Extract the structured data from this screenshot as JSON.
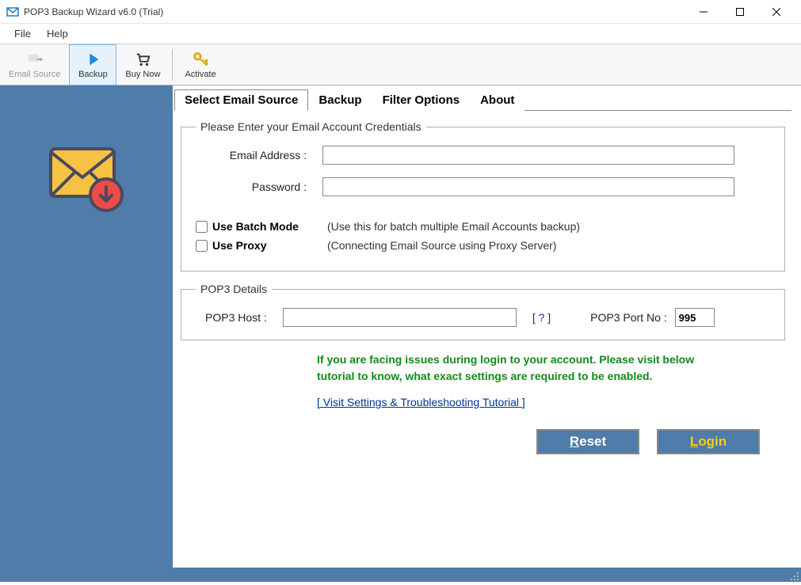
{
  "window": {
    "title": "POP3 Backup Wizard v6.0 (Trial)"
  },
  "menu": {
    "file": "File",
    "help": "Help"
  },
  "toolbar": {
    "email_source": "Email Source",
    "backup": "Backup",
    "buy_now": "Buy Now",
    "activate": "Activate"
  },
  "tabs": {
    "select_email_source": "Select Email Source",
    "backup": "Backup",
    "filter_options": "Filter Options",
    "about": "About"
  },
  "credentials": {
    "legend": "Please Enter your Email Account Credentials",
    "email_label": "Email Address :",
    "email_value": "",
    "password_label": "Password :",
    "password_value": "",
    "batch_label": "Use Batch Mode",
    "batch_hint": "(Use this for batch multiple Email Accounts backup)",
    "proxy_label": "Use Proxy",
    "proxy_hint": "(Connecting Email Source using Proxy Server)"
  },
  "pop3": {
    "legend": "POP3 Details",
    "host_label": "POP3 Host :",
    "host_value": "",
    "help": "[ ? ]",
    "port_label": "POP3 Port No :",
    "port_value": "995"
  },
  "tip": "If you are facing issues during login to your account. Please visit below tutorial to know, what exact settings are required to be enabled.",
  "tutorial_link": "[ Visit Settings & Troubleshooting Tutorial ]",
  "buttons": {
    "reset": "Reset",
    "reset_key": "R",
    "login": "Login",
    "login_key": "L"
  }
}
